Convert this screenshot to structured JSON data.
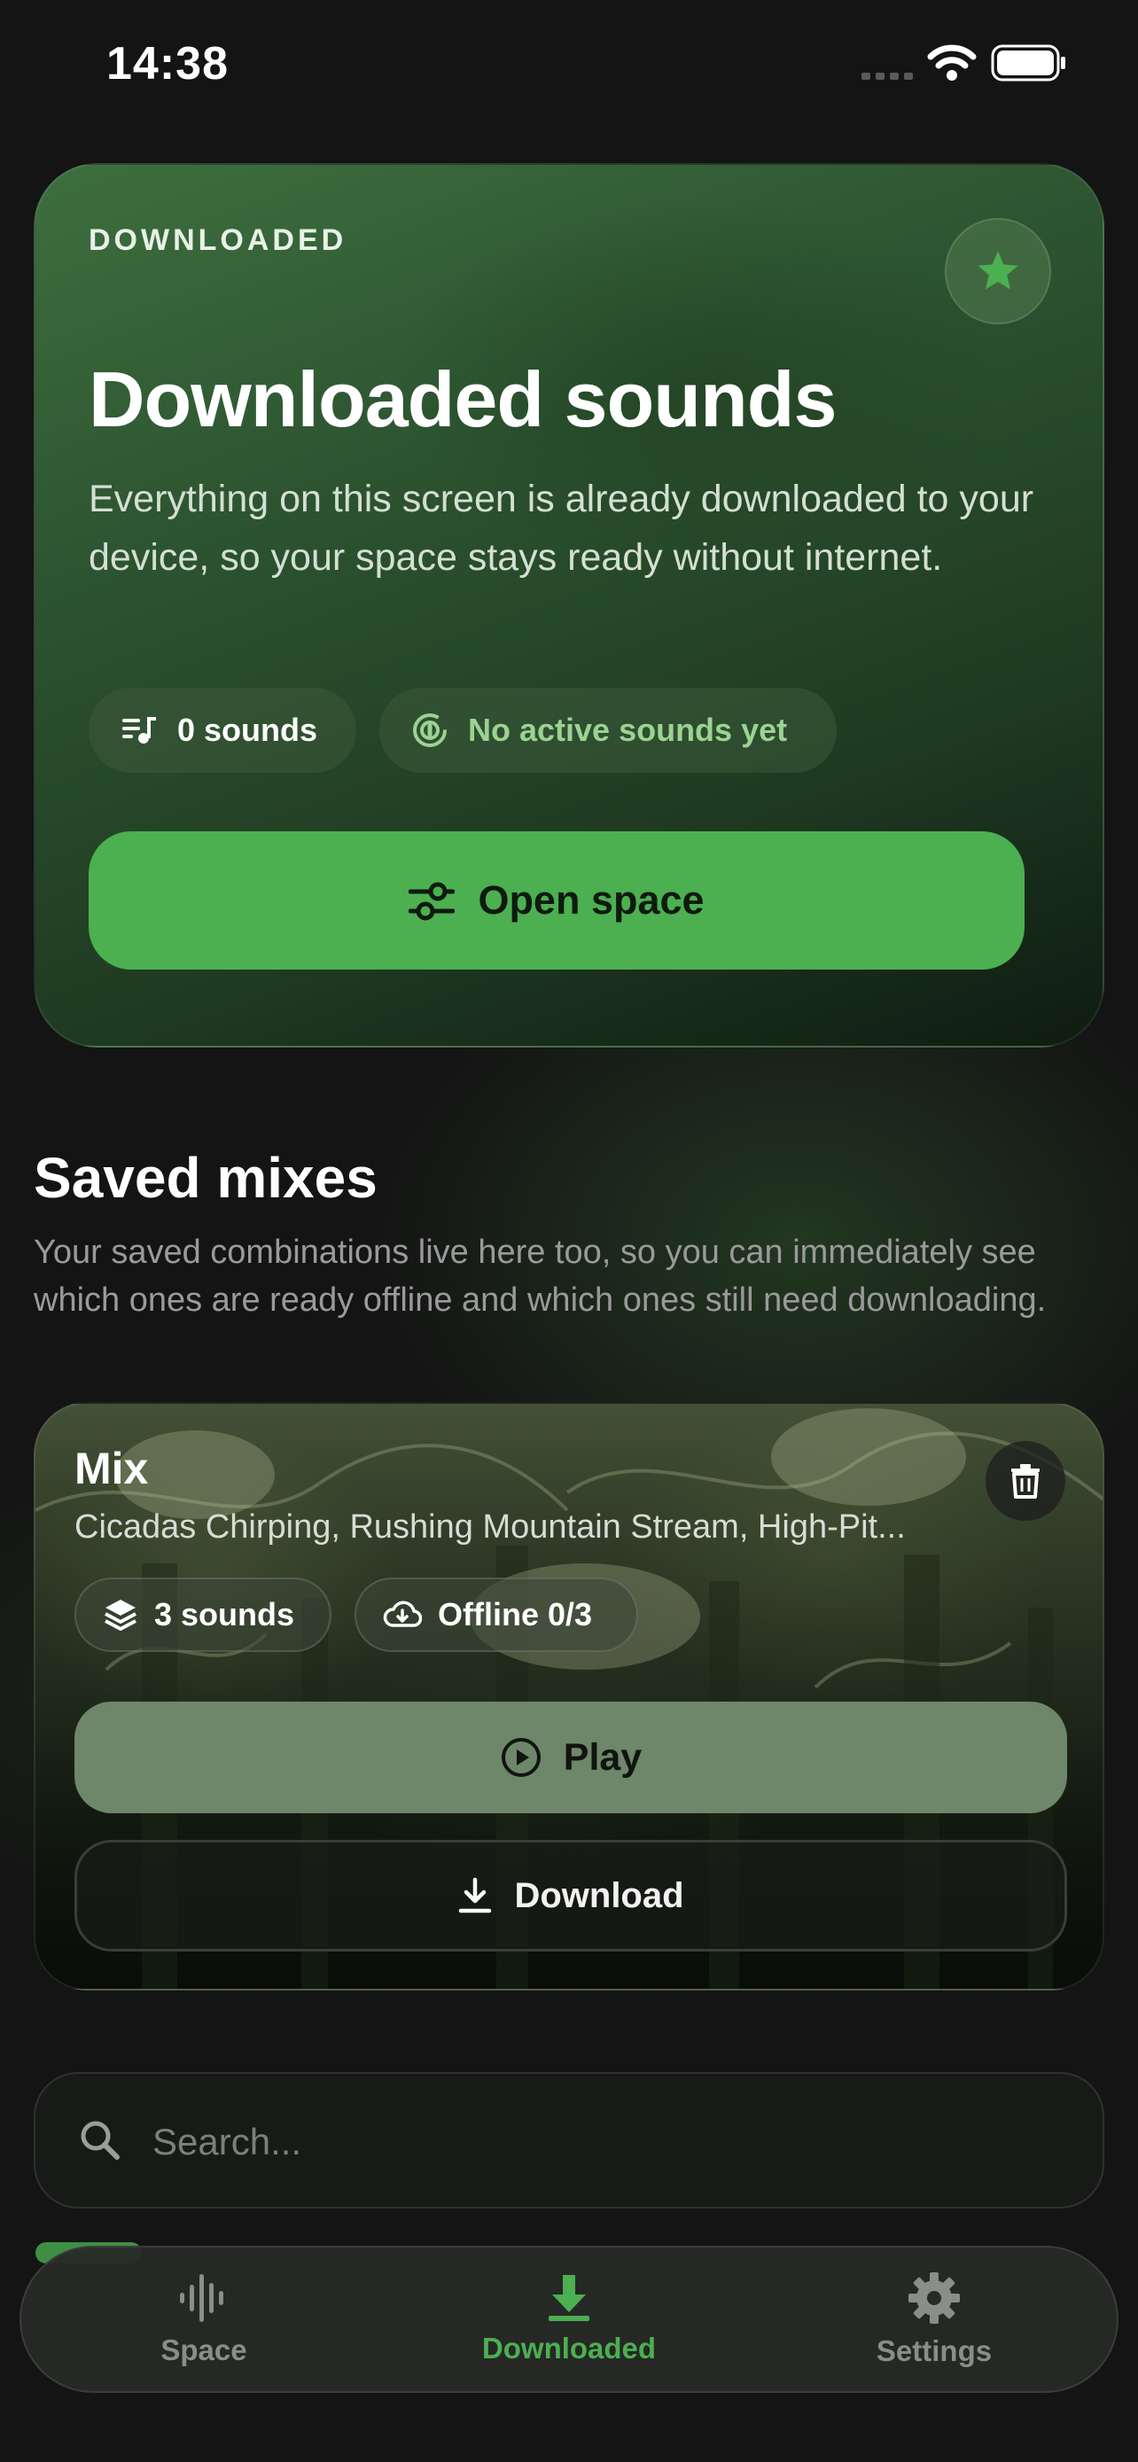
{
  "status_bar": {
    "time": "14:38"
  },
  "hero": {
    "eyebrow": "DOWNLOADED",
    "title": "Downloaded sounds",
    "description": "Everything on this screen is already downloaded to your device, so your space stays ready without internet.",
    "sounds_chip": "0 sounds",
    "active_chip": "No active sounds yet",
    "open_button": "Open space"
  },
  "saved_mixes": {
    "title": "Saved mixes",
    "description": "Your saved combinations live here too, so you can immediately see which ones are ready offline and which ones still need downloading.",
    "mixes": [
      {
        "title": "Mix",
        "subtitle": "Cicadas Chirping, Rushing Mountain Stream, High-Pit...",
        "sounds_chip": "3 sounds",
        "offline_chip": "Offline 0/3",
        "play_label": "Play",
        "download_label": "Download"
      }
    ]
  },
  "search": {
    "placeholder": "Search..."
  },
  "tabs": [
    {
      "label": "Space",
      "icon": "waveform-icon",
      "active": false
    },
    {
      "label": "Downloaded",
      "icon": "download-icon",
      "active": true
    },
    {
      "label": "Settings",
      "icon": "gear-icon",
      "active": false
    }
  ],
  "colors": {
    "accent": "#4caf50",
    "active_chip_text": "#9bd392",
    "background": "#141414",
    "play_button": "#6e866a"
  }
}
